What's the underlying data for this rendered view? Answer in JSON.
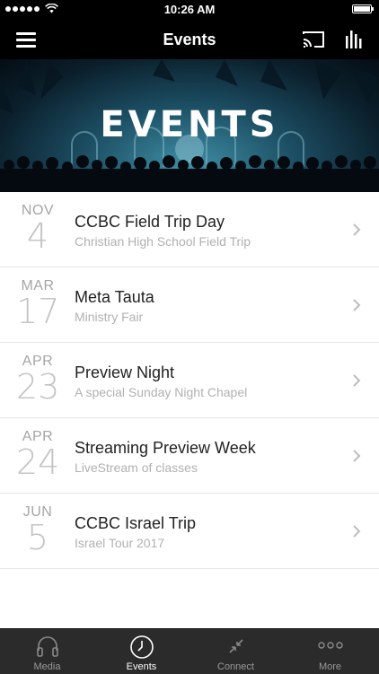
{
  "status_bar": {
    "time": "10:26 AM"
  },
  "nav": {
    "title": "Events"
  },
  "hero": {
    "title": "EVENTS"
  },
  "events": [
    {
      "month": "NOV",
      "day": "4",
      "title": "CCBC Field Trip Day",
      "subtitle": "Christian High School Field Trip"
    },
    {
      "month": "MAR",
      "day": "17",
      "title": "Meta Tauta",
      "subtitle": "Ministry Fair"
    },
    {
      "month": "APR",
      "day": "23",
      "title": "Preview Night",
      "subtitle": "A special Sunday Night Chapel"
    },
    {
      "month": "APR",
      "day": "24",
      "title": "Streaming Preview Week",
      "subtitle": "LiveStream of classes"
    },
    {
      "month": "JUN",
      "day": "5",
      "title": "CCBC Israel Trip",
      "subtitle": "Israel Tour 2017"
    }
  ],
  "tabs": [
    {
      "label": "Media",
      "icon": "headphones-icon"
    },
    {
      "label": "Events",
      "icon": "clock-icon",
      "active": true
    },
    {
      "label": "Connect",
      "icon": "connect-arrows-icon"
    },
    {
      "label": "More",
      "icon": "more-dots-icon"
    }
  ],
  "colors": {
    "bar_background": "#000000",
    "tab_bar_background": "#2b2b2b",
    "accent": "#ffffff"
  }
}
